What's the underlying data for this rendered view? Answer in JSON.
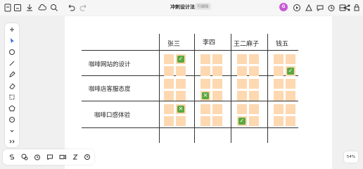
{
  "topbar": {
    "title": "冲刺设计法",
    "status": "可编辑",
    "avatar_initial": "G",
    "left_icons": [
      "document-icon",
      "home-icon",
      "download-icon",
      "cloud-icon",
      "search-icon",
      "undo-icon",
      "redo-icon"
    ],
    "right_icons": [
      "play-icon",
      "shapes-icon",
      "comment-icon",
      "timer-icon",
      "more-icon",
      "share-icon",
      "lock-icon"
    ]
  },
  "left_tools": [
    "plus-icon",
    "cursor-icon",
    "circle-icon",
    "line-icon",
    "pen-icon",
    "eraser-icon",
    "crop-icon",
    "pentagon-icon",
    "sticker-icon",
    "chevron-down-icon",
    "chevrons-right-icon"
  ],
  "bottom_tools": [
    "template-icon",
    "chat-icon",
    "timer-icon",
    "comment-icon",
    "video-icon",
    "text-icon",
    "history-icon"
  ],
  "zoom": "54%",
  "table": {
    "columns": [
      "张三",
      "李四",
      "王二麻子",
      "钱五"
    ],
    "rows": [
      "咖啡网站的设计",
      "咖啡店客服态度",
      "咖啡口感体验"
    ],
    "marks": [
      {
        "row": 0,
        "col": 0,
        "type": "check"
      },
      {
        "row": 0,
        "col": 3,
        "type": "check"
      },
      {
        "row": 1,
        "col": 1,
        "type": "cross"
      },
      {
        "row": 2,
        "col": 2,
        "type": "check"
      },
      {
        "row": 2,
        "col": 0,
        "type": "cross"
      }
    ]
  }
}
